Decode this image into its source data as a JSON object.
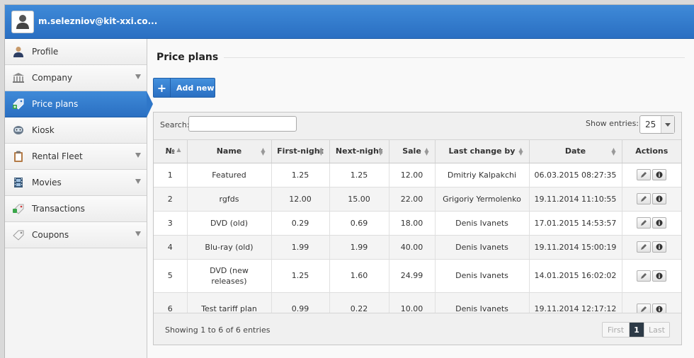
{
  "header": {
    "user_email": "m.selezniov@kit-xxi.co..."
  },
  "sidebar": {
    "items": [
      {
        "label": "Profile",
        "icon": "person-icon",
        "has_caret": false,
        "active": false
      },
      {
        "label": "Company",
        "icon": "bank-icon",
        "has_caret": true,
        "active": false
      },
      {
        "label": "Price plans",
        "icon": "price-tag-icon",
        "has_caret": false,
        "active": true
      },
      {
        "label": "Kiosk",
        "icon": "kiosk-icon",
        "has_caret": false,
        "active": false
      },
      {
        "label": "Rental Fleet",
        "icon": "clipboard-icon",
        "has_caret": true,
        "active": false
      },
      {
        "label": "Movies",
        "icon": "film-icon",
        "has_caret": true,
        "active": false
      },
      {
        "label": "Transactions",
        "icon": "transactions-icon",
        "has_caret": false,
        "active": false
      },
      {
        "label": "Coupons",
        "icon": "coupon-icon",
        "has_caret": true,
        "active": false
      }
    ]
  },
  "main": {
    "title": "Price plans",
    "add_label": "Add new",
    "search_label": "Search:",
    "search_value": "",
    "entries_label": "Show entries:",
    "entries_value": "25",
    "columns": [
      "№",
      "Name",
      "First-night",
      "Next-night",
      "Sale",
      "Last change by",
      "Date",
      "Actions"
    ],
    "rows": [
      {
        "num": "1",
        "name": "Featured",
        "first": "1.25",
        "next": "1.25",
        "sale": "12.00",
        "by": "Dmitriy Kalpakchi",
        "date": "06.03.2015 08:27:35"
      },
      {
        "num": "2",
        "name": "rgfds",
        "first": "12.00",
        "next": "15.00",
        "sale": "22.00",
        "by": "Grigoriy Yermolenko",
        "date": "19.11.2014 11:10:55"
      },
      {
        "num": "3",
        "name": "DVD (old)",
        "first": "0.29",
        "next": "0.69",
        "sale": "18.00",
        "by": "Denis Ivanets",
        "date": "17.01.2015 14:53:57"
      },
      {
        "num": "4",
        "name": "Blu-ray (old)",
        "first": "1.99",
        "next": "1.99",
        "sale": "40.00",
        "by": "Denis Ivanets",
        "date": "19.11.2014 15:00:19"
      },
      {
        "num": "5",
        "name": "DVD (new releases)",
        "first": "1.25",
        "next": "1.60",
        "sale": "24.99",
        "by": "Denis Ivanets",
        "date": "14.01.2015 16:02:02"
      },
      {
        "num": "6",
        "name": "Test tariff plan",
        "first": "0.99",
        "next": "0.22",
        "sale": "10.00",
        "by": "Denis Ivanets",
        "date": "19.11.2014 12:17:12"
      }
    ],
    "footer_info": "Showing 1 to 6 of 6 entries",
    "pager": {
      "first": "First",
      "current": "1",
      "last": "Last"
    }
  },
  "colors": {
    "accent": "#2f77c9",
    "active_page": "#2d3a47"
  }
}
